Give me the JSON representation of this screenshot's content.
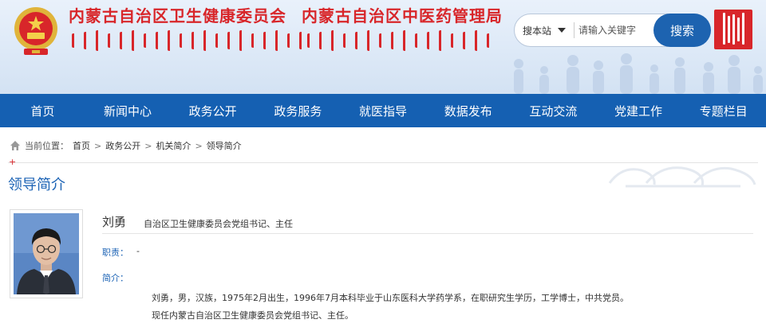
{
  "header": {
    "title_health": "内蒙古自治区卫生健康委员会",
    "title_tcm": "内蒙古自治区中医药管理局",
    "search_scope": "搜本站",
    "search_placeholder": "请输入关键字",
    "search_button": "搜索"
  },
  "nav": {
    "items": [
      "首页",
      "新闻中心",
      "政务公开",
      "政务服务",
      "就医指导",
      "数据发布",
      "互动交流",
      "党建工作",
      "专题栏目"
    ]
  },
  "breadcrumb": {
    "prefix": "当前位置：",
    "items": [
      "首页",
      "政务公开",
      "机关简介",
      "领导简介"
    ],
    "separator": ">"
  },
  "section": {
    "title": "领导简介"
  },
  "profile": {
    "name": "刘勇",
    "position": "自治区卫生健康委员会党组书记、主任",
    "duty_label": "职责：",
    "duty_value": "-",
    "intro_label": "简介：",
    "intro_line1": "刘勇，男，汉族，1975年2月出生，1996年7月本科毕业于山东医科大学药学系，在职研究生学历，工学博士，中共党员。",
    "intro_line2": "现任内蒙古自治区卫生健康委员会党组书记、主任。"
  },
  "colors": {
    "brand_red": "#d8262a",
    "nav_blue": "#1560b2",
    "accent_blue": "#1c63b5"
  }
}
